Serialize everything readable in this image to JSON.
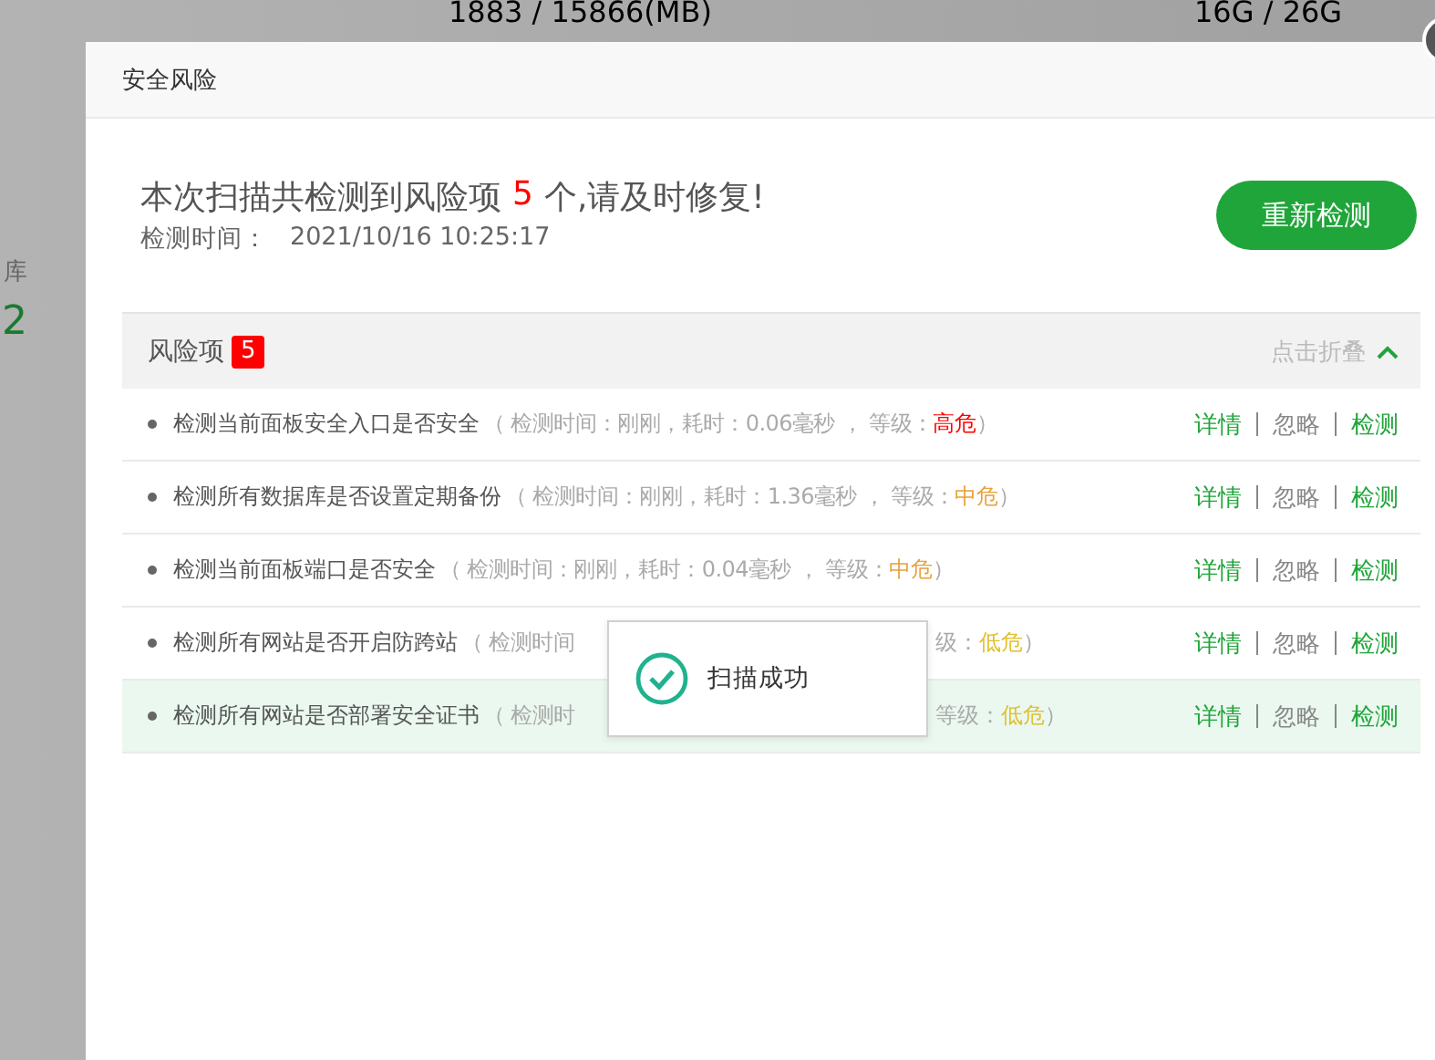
{
  "background": {
    "memory": "1883 / 15866(MB)",
    "disk": "16G / 26G",
    "side_label": "库",
    "side_value": "2"
  },
  "dialog": {
    "title": "安全风险",
    "summary": {
      "prefix": "本次扫描共检测到风险项",
      "count": "5",
      "suffix": "个,请及时修复!",
      "time_label": "检测时间：",
      "time": "2021/10/16 10:25:17"
    },
    "rescan_button": "重新检测",
    "risk_header": {
      "label": "风险项",
      "count": "5",
      "toggle": "点击折叠",
      "expanded": true
    },
    "rows": [
      {
        "name": "检测当前面板安全入口是否安全",
        "detail": "（ 检测时间：刚刚，耗时：0.06毫秒 ， 等级：",
        "risk": "高危",
        "color": "#ff0000",
        "close": "）",
        "hovered": false,
        "actions": [
          {
            "label": "详情",
            "kind": "link"
          },
          {
            "label": "忽略",
            "kind": "muted"
          },
          {
            "label": "检测",
            "kind": "link"
          }
        ]
      },
      {
        "name": "检测所有数据库是否设置定期备份",
        "detail": "（ 检测时间：刚刚，耗时：1.36毫秒 ， 等级：",
        "risk": "中危",
        "color": "#e6a23c",
        "close": "）",
        "hovered": false,
        "actions": [
          {
            "label": "详情",
            "kind": "link"
          },
          {
            "label": "忽略",
            "kind": "muted"
          },
          {
            "label": "检测",
            "kind": "link"
          }
        ]
      },
      {
        "name": "检测当前面板端口是否安全",
        "detail": "（ 检测时间：刚刚，耗时：0.04毫秒 ， 等级：",
        "risk": "中危",
        "color": "#e6a23c",
        "close": "）",
        "hovered": false,
        "actions": [
          {
            "label": "详情",
            "kind": "link"
          },
          {
            "label": "忽略",
            "kind": "muted"
          },
          {
            "label": "检测",
            "kind": "link"
          }
        ]
      },
      {
        "name": "检测所有网站是否开启防跨站",
        "detail": "（ 检测时间",
        "detail_after": "级：",
        "risk": "低危",
        "color": "#e0c030",
        "close": "）",
        "hovered": false,
        "actions": [
          {
            "label": "详情",
            "kind": "link"
          },
          {
            "label": "忽略",
            "kind": "muted"
          },
          {
            "label": "检测",
            "kind": "link"
          }
        ]
      },
      {
        "name": "检测所有网站是否部署安全证书",
        "detail": "（ 检测时",
        "detail_after": "等级：",
        "risk": "低危",
        "color": "#e0c030",
        "close": "）",
        "hovered": true,
        "actions": [
          {
            "label": "详情",
            "kind": "link"
          },
          {
            "label": "忽略",
            "kind": "muted"
          },
          {
            "label": "检测",
            "kind": "link"
          }
        ]
      }
    ]
  },
  "toast": {
    "message": "扫描成功"
  }
}
